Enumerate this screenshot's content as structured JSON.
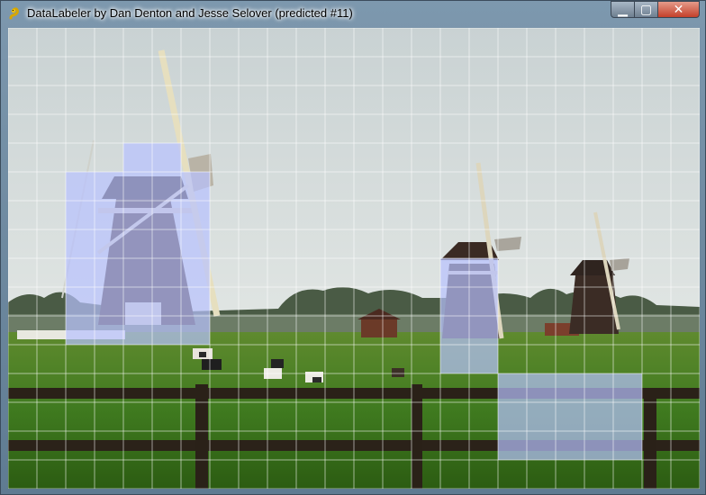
{
  "window": {
    "title": "DataLabeler by Dan Denton and Jesse Selover (predicted #11)",
    "buttons": {
      "minimize": "▁",
      "maximize": "▢",
      "close": "✕"
    }
  },
  "canvas": {
    "description_icon": "pygame-snake-icon",
    "grid": {
      "columns": 24,
      "rows": 16,
      "line_color": "#ffffff"
    },
    "selection_color": "#b8c2ff",
    "selected_cells": [
      [
        4,
        4
      ],
      [
        5,
        4
      ],
      [
        2,
        5
      ],
      [
        3,
        5
      ],
      [
        4,
        5
      ],
      [
        5,
        5
      ],
      [
        6,
        5
      ],
      [
        2,
        6
      ],
      [
        3,
        6
      ],
      [
        4,
        6
      ],
      [
        5,
        6
      ],
      [
        6,
        6
      ],
      [
        2,
        7
      ],
      [
        3,
        7
      ],
      [
        4,
        7
      ],
      [
        5,
        7
      ],
      [
        6,
        7
      ],
      [
        2,
        8
      ],
      [
        3,
        8
      ],
      [
        4,
        8
      ],
      [
        5,
        8
      ],
      [
        6,
        8
      ],
      [
        2,
        9
      ],
      [
        3,
        9
      ],
      [
        4,
        9
      ],
      [
        5,
        9
      ],
      [
        6,
        9
      ],
      [
        2,
        10
      ],
      [
        3,
        10
      ],
      [
        4,
        10
      ],
      [
        5,
        10
      ],
      [
        6,
        10
      ],
      [
        15,
        8
      ],
      [
        16,
        8
      ],
      [
        15,
        9
      ],
      [
        16,
        9
      ],
      [
        15,
        10
      ],
      [
        16,
        10
      ],
      [
        15,
        11
      ],
      [
        16,
        11
      ],
      [
        17,
        12
      ],
      [
        18,
        12
      ],
      [
        19,
        12
      ],
      [
        20,
        12
      ],
      [
        21,
        12
      ],
      [
        17,
        13
      ],
      [
        18,
        13
      ],
      [
        19,
        13
      ],
      [
        20,
        13
      ],
      [
        21,
        13
      ],
      [
        17,
        14
      ],
      [
        18,
        14
      ],
      [
        19,
        14
      ],
      [
        20,
        14
      ],
      [
        21,
        14
      ]
    ]
  }
}
